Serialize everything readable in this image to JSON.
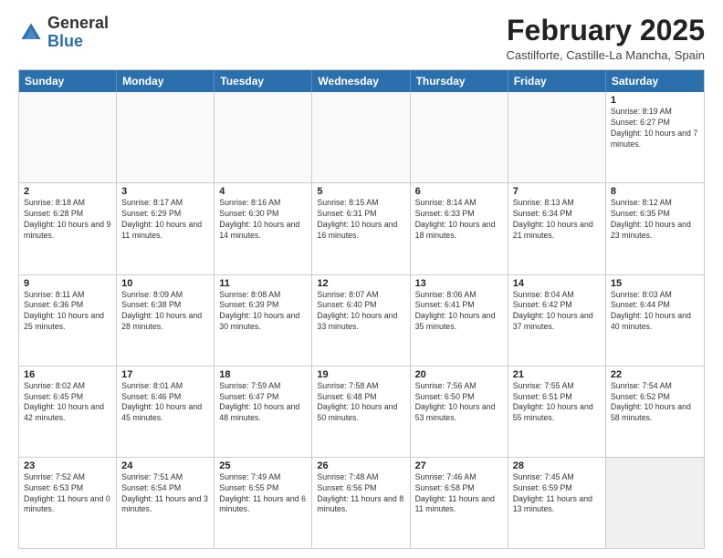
{
  "header": {
    "logo_general": "General",
    "logo_blue": "Blue",
    "month_title": "February 2025",
    "location": "Castilforte, Castille-La Mancha, Spain"
  },
  "days_of_week": [
    "Sunday",
    "Monday",
    "Tuesday",
    "Wednesday",
    "Thursday",
    "Friday",
    "Saturday"
  ],
  "weeks": [
    [
      {
        "day": "",
        "info": "",
        "empty": true
      },
      {
        "day": "",
        "info": "",
        "empty": true
      },
      {
        "day": "",
        "info": "",
        "empty": true
      },
      {
        "day": "",
        "info": "",
        "empty": true
      },
      {
        "day": "",
        "info": "",
        "empty": true
      },
      {
        "day": "",
        "info": "",
        "empty": true
      },
      {
        "day": "1",
        "info": "Sunrise: 8:19 AM\nSunset: 6:27 PM\nDaylight: 10 hours\nand 7 minutes."
      }
    ],
    [
      {
        "day": "2",
        "info": "Sunrise: 8:18 AM\nSunset: 6:28 PM\nDaylight: 10 hours\nand 9 minutes."
      },
      {
        "day": "3",
        "info": "Sunrise: 8:17 AM\nSunset: 6:29 PM\nDaylight: 10 hours\nand 11 minutes."
      },
      {
        "day": "4",
        "info": "Sunrise: 8:16 AM\nSunset: 6:30 PM\nDaylight: 10 hours\nand 14 minutes."
      },
      {
        "day": "5",
        "info": "Sunrise: 8:15 AM\nSunset: 6:31 PM\nDaylight: 10 hours\nand 16 minutes."
      },
      {
        "day": "6",
        "info": "Sunrise: 8:14 AM\nSunset: 6:33 PM\nDaylight: 10 hours\nand 18 minutes."
      },
      {
        "day": "7",
        "info": "Sunrise: 8:13 AM\nSunset: 6:34 PM\nDaylight: 10 hours\nand 21 minutes."
      },
      {
        "day": "8",
        "info": "Sunrise: 8:12 AM\nSunset: 6:35 PM\nDaylight: 10 hours\nand 23 minutes."
      }
    ],
    [
      {
        "day": "9",
        "info": "Sunrise: 8:11 AM\nSunset: 6:36 PM\nDaylight: 10 hours\nand 25 minutes."
      },
      {
        "day": "10",
        "info": "Sunrise: 8:09 AM\nSunset: 6:38 PM\nDaylight: 10 hours\nand 28 minutes."
      },
      {
        "day": "11",
        "info": "Sunrise: 8:08 AM\nSunset: 6:39 PM\nDaylight: 10 hours\nand 30 minutes."
      },
      {
        "day": "12",
        "info": "Sunrise: 8:07 AM\nSunset: 6:40 PM\nDaylight: 10 hours\nand 33 minutes."
      },
      {
        "day": "13",
        "info": "Sunrise: 8:06 AM\nSunset: 6:41 PM\nDaylight: 10 hours\nand 35 minutes."
      },
      {
        "day": "14",
        "info": "Sunrise: 8:04 AM\nSunset: 6:42 PM\nDaylight: 10 hours\nand 37 minutes."
      },
      {
        "day": "15",
        "info": "Sunrise: 8:03 AM\nSunset: 6:44 PM\nDaylight: 10 hours\nand 40 minutes."
      }
    ],
    [
      {
        "day": "16",
        "info": "Sunrise: 8:02 AM\nSunset: 6:45 PM\nDaylight: 10 hours\nand 42 minutes."
      },
      {
        "day": "17",
        "info": "Sunrise: 8:01 AM\nSunset: 6:46 PM\nDaylight: 10 hours\nand 45 minutes."
      },
      {
        "day": "18",
        "info": "Sunrise: 7:59 AM\nSunset: 6:47 PM\nDaylight: 10 hours\nand 48 minutes."
      },
      {
        "day": "19",
        "info": "Sunrise: 7:58 AM\nSunset: 6:48 PM\nDaylight: 10 hours\nand 50 minutes."
      },
      {
        "day": "20",
        "info": "Sunrise: 7:56 AM\nSunset: 6:50 PM\nDaylight: 10 hours\nand 53 minutes."
      },
      {
        "day": "21",
        "info": "Sunrise: 7:55 AM\nSunset: 6:51 PM\nDaylight: 10 hours\nand 55 minutes."
      },
      {
        "day": "22",
        "info": "Sunrise: 7:54 AM\nSunset: 6:52 PM\nDaylight: 10 hours\nand 58 minutes."
      }
    ],
    [
      {
        "day": "23",
        "info": "Sunrise: 7:52 AM\nSunset: 6:53 PM\nDaylight: 11 hours\nand 0 minutes."
      },
      {
        "day": "24",
        "info": "Sunrise: 7:51 AM\nSunset: 6:54 PM\nDaylight: 11 hours\nand 3 minutes."
      },
      {
        "day": "25",
        "info": "Sunrise: 7:49 AM\nSunset: 6:55 PM\nDaylight: 11 hours\nand 6 minutes."
      },
      {
        "day": "26",
        "info": "Sunrise: 7:48 AM\nSunset: 6:56 PM\nDaylight: 11 hours\nand 8 minutes."
      },
      {
        "day": "27",
        "info": "Sunrise: 7:46 AM\nSunset: 6:58 PM\nDaylight: 11 hours\nand 11 minutes."
      },
      {
        "day": "28",
        "info": "Sunrise: 7:45 AM\nSunset: 6:59 PM\nDaylight: 11 hours\nand 13 minutes."
      },
      {
        "day": "",
        "info": "",
        "empty": true,
        "shaded": true
      }
    ]
  ]
}
